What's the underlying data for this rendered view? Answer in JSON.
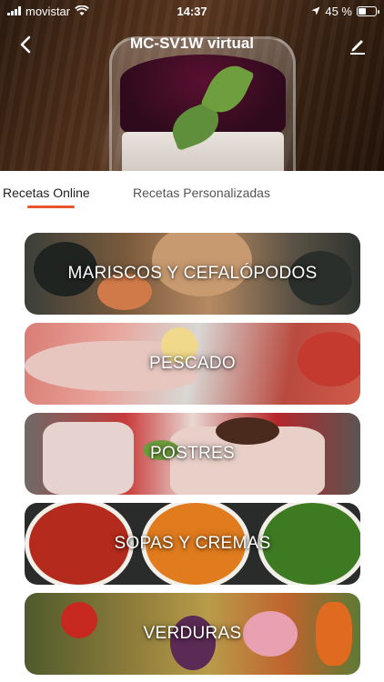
{
  "status_bar": {
    "carrier": "movistar",
    "time": "14:37",
    "battery_percent": "45 %",
    "battery_level": 0.45
  },
  "header": {
    "title": "MC-SV1W virtual",
    "back_icon": "chevron-left-icon",
    "edit_icon": "pencil-icon"
  },
  "tabs": [
    {
      "label": "Recetas Online",
      "active": true
    },
    {
      "label": "Recetas Personalizadas",
      "active": false
    }
  ],
  "categories": [
    {
      "label": "MARISCOS Y CEFALÓPODOS"
    },
    {
      "label": "PESCADO"
    },
    {
      "label": "POSTRES"
    },
    {
      "label": "SOPAS Y CREMAS"
    },
    {
      "label": "VERDURAS"
    }
  ],
  "colors": {
    "accent": "#e8542b",
    "text_primary": "#222222",
    "text_secondary": "#555555"
  }
}
